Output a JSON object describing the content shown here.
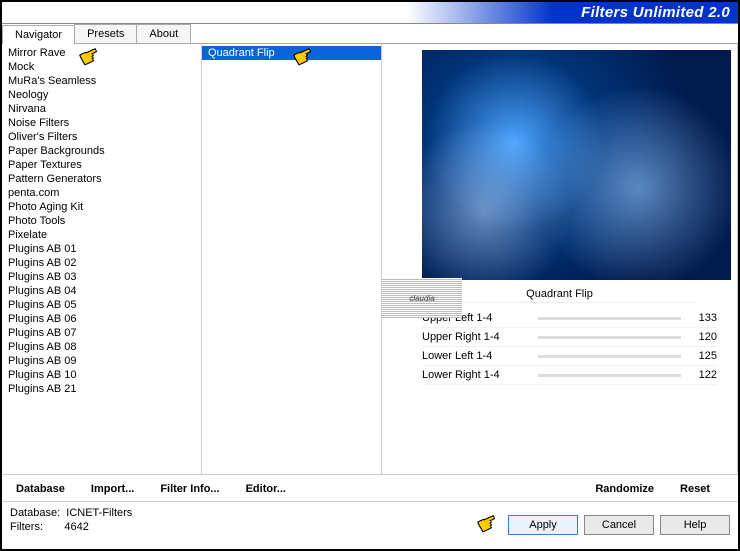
{
  "title": "Filters Unlimited 2.0",
  "tabs": [
    "Navigator",
    "Presets",
    "About"
  ],
  "activeTab": 0,
  "categories": [
    "Mirror Rave",
    "Mock",
    "MuRa's Seamless",
    "Neology",
    "Nirvana",
    "Noise Filters",
    "Oliver's Filters",
    "Paper Backgrounds",
    "Paper Textures",
    "Pattern Generators",
    "penta.com",
    "Photo Aging Kit",
    "Photo Tools",
    "Pixelate",
    "Plugins AB 01",
    "Plugins AB 02",
    "Plugins AB 03",
    "Plugins AB 04",
    "Plugins AB 05",
    "Plugins AB 06",
    "Plugins AB 07",
    "Plugins AB 08",
    "Plugins AB 09",
    "Plugins AB 10",
    "Plugins AB 21"
  ],
  "filters": [
    "Quadrant Flip"
  ],
  "selectedFilter": "Quadrant Flip",
  "currentFilterName": "Quadrant Flip",
  "watermark": "claudia",
  "params": [
    {
      "label": "Upper Left 1-4",
      "value": 133
    },
    {
      "label": "Upper Right 1-4",
      "value": 120
    },
    {
      "label": "Lower Left 1-4",
      "value": 125
    },
    {
      "label": "Lower Right 1-4",
      "value": 122
    }
  ],
  "leftButtons": [
    "Database",
    "Import...",
    "Filter Info...",
    "Editor..."
  ],
  "rightButtons": [
    "Randomize",
    "Reset"
  ],
  "footer": {
    "dbLabel": "Database:",
    "dbValue": "ICNET-Filters",
    "filtLabel": "Filters:",
    "filtValue": "4642"
  },
  "actions": {
    "apply": "Apply",
    "cancel": "Cancel",
    "help": "Help"
  }
}
